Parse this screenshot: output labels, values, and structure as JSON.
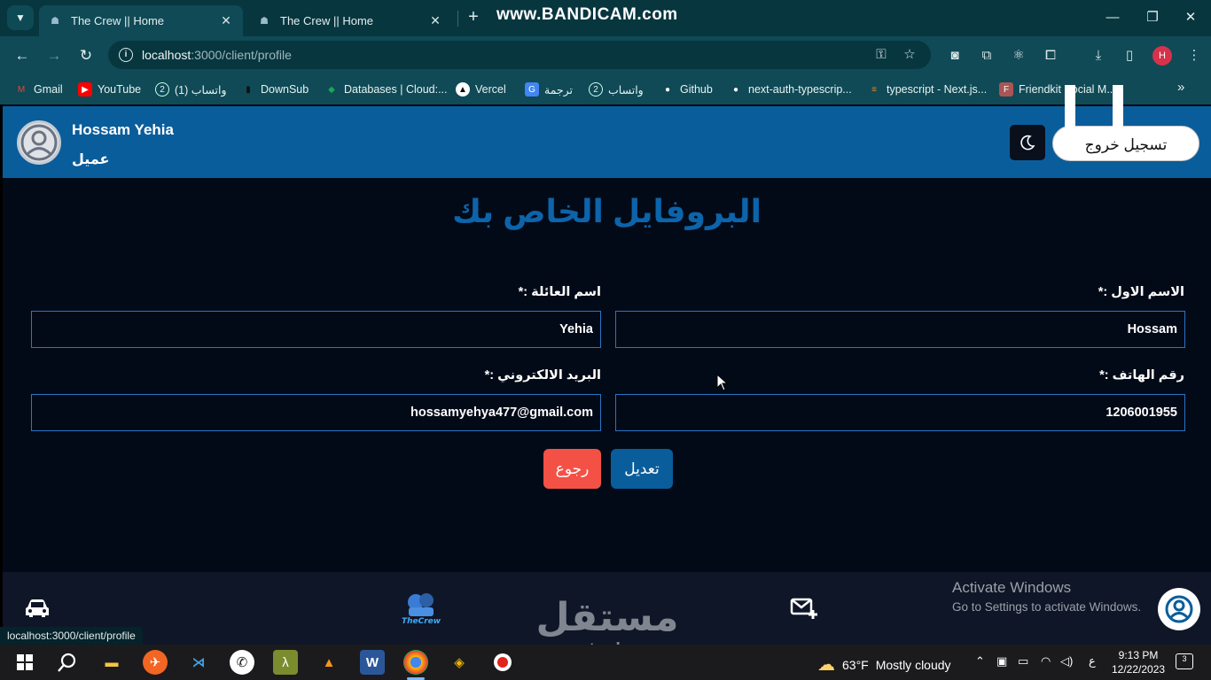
{
  "browser": {
    "tabs": [
      {
        "title": "The Crew || Home",
        "active": true
      },
      {
        "title": "The Crew || Home",
        "active": false
      }
    ],
    "recorder_watermark": "www.BANDICAM.com",
    "url_host": "localhost",
    "url_path": ":3000/client/profile",
    "profile_initial": "H",
    "bookmarks": [
      {
        "label": "Gmail",
        "icon": "gmail-icon"
      },
      {
        "label": "YouTube",
        "icon": "youtube-icon"
      },
      {
        "label": "واتساب (1)",
        "icon": "whatsapp-icon"
      },
      {
        "label": "DownSub",
        "icon": "downsub-icon"
      },
      {
        "label": "Databases | Cloud:...",
        "icon": "mongodb-icon"
      },
      {
        "label": "Vercel",
        "icon": "vercel-icon"
      },
      {
        "label": "ترجمة",
        "icon": "translate-icon"
      },
      {
        "label": "واتساب",
        "icon": "whatsapp-icon"
      },
      {
        "label": "Github",
        "icon": "github-icon"
      },
      {
        "label": "next-auth-typescrip...",
        "icon": "github-icon"
      },
      {
        "label": "typescript - Next.js...",
        "icon": "stackoverflow-icon"
      },
      {
        "label": "Friendkit Social M...",
        "icon": "friendkit-icon"
      }
    ],
    "status_url": "localhost:3000/client/profile"
  },
  "header": {
    "user_name": "Hossam Yehia",
    "user_role": "عميل",
    "logout_label": "تسجيل خروج"
  },
  "profile": {
    "title": "البروفايل الخاص بك",
    "first_name_label": "الاسم الاول :*",
    "first_name_value": "Hossam",
    "last_name_label": "اسم العائلة :*",
    "last_name_value": "Yehia",
    "phone_label": "رقم الهاتف :*",
    "phone_value": "1206001955",
    "email_label": "البريد الالكتروني :*",
    "email_value": "hossamyehya477@gmail.com",
    "edit_label": "تعديل",
    "back_label": "رجوع"
  },
  "footer": {
    "activate_title": "Activate Windows",
    "activate_sub": "Go to Settings to activate Windows."
  },
  "watermark": {
    "arabic": "مستقل",
    "latin": "mostaql.com"
  },
  "taskbar": {
    "weather_temp": "63°F",
    "weather_desc": "Mostly cloudy",
    "lang": "ع",
    "time": "9:13 PM",
    "date": "12/22/2023",
    "notif_count": "3"
  },
  "colors": {
    "header_blue": "#0a5d9b",
    "page_bg": "#030a17",
    "field_border": "#2b74c4",
    "back_red": "#f45146"
  }
}
